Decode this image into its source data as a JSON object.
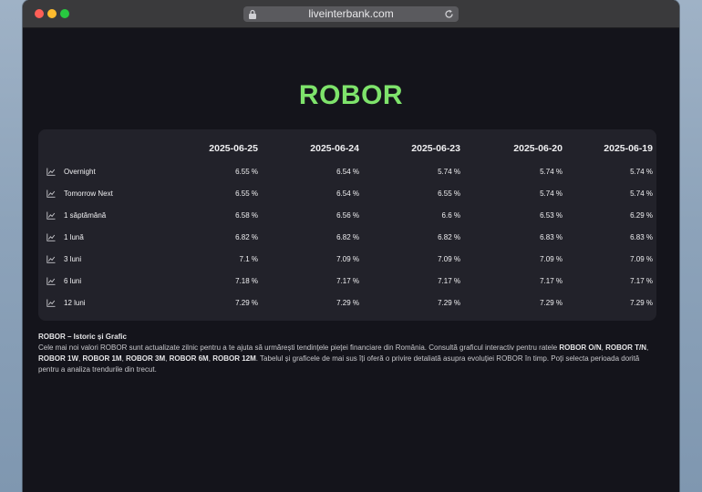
{
  "browser": {
    "url": "liveinterbank.com",
    "icons": {
      "lock": "lock-icon",
      "reload": "reload-icon"
    }
  },
  "page": {
    "title": "ROBOR",
    "accent_color": "#7ee36b"
  },
  "table": {
    "dates": [
      "2025-06-25",
      "2025-06-24",
      "2025-06-23",
      "2025-06-20",
      "2025-06-19"
    ],
    "rows": [
      {
        "label": "Overnight",
        "values": [
          "6.55 %",
          "6.54 %",
          "5.74 %",
          "5.74 %",
          "5.74 %"
        ]
      },
      {
        "label": "Tomorrow Next",
        "values": [
          "6.55 %",
          "6.54 %",
          "6.55 %",
          "5.74 %",
          "5.74 %"
        ]
      },
      {
        "label": "1 săptămână",
        "values": [
          "6.58 %",
          "6.56 %",
          "6.6 %",
          "6.53 %",
          "6.29 %"
        ]
      },
      {
        "label": "1 lună",
        "values": [
          "6.82 %",
          "6.82 %",
          "6.82 %",
          "6.83 %",
          "6.83 %"
        ]
      },
      {
        "label": "3 luni",
        "values": [
          "7.1 %",
          "7.09 %",
          "7.09 %",
          "7.09 %",
          "7.09 %"
        ]
      },
      {
        "label": "6 luni",
        "values": [
          "7.18 %",
          "7.17 %",
          "7.17 %",
          "7.17 %",
          "7.17 %"
        ]
      },
      {
        "label": "12 luni",
        "values": [
          "7.29 %",
          "7.29 %",
          "7.29 %",
          "7.29 %",
          "7.29 %"
        ]
      }
    ],
    "row_icon": "chart-line-icon"
  },
  "footer": {
    "heading": "ROBOR – Istoric și Grafic",
    "p1": "Cele mai noi valori ROBOR sunt actualizate zilnic pentru a te ajuta să urmărești tendințele pieței financiare din România. Consultă graficul interactiv pentru ratele ",
    "b1": "ROBOR O/N",
    "s1": ", ",
    "b2": "ROBOR T/N",
    "s2": ", ",
    "b3": "ROBOR 1W",
    "s3": ", ",
    "b4": "ROBOR 1M",
    "s4": ", ",
    "b5": "ROBOR 3M",
    "s5": ", ",
    "b6": "ROBOR 6M",
    "s6": ", ",
    "b7": "ROBOR 12M",
    "p2": ". Tabelul și graficele de mai sus îți oferă o privire detaliată asupra evoluției ROBOR în timp. Poți selecta perioada dorită pentru a analiza trendurile din trecut."
  }
}
